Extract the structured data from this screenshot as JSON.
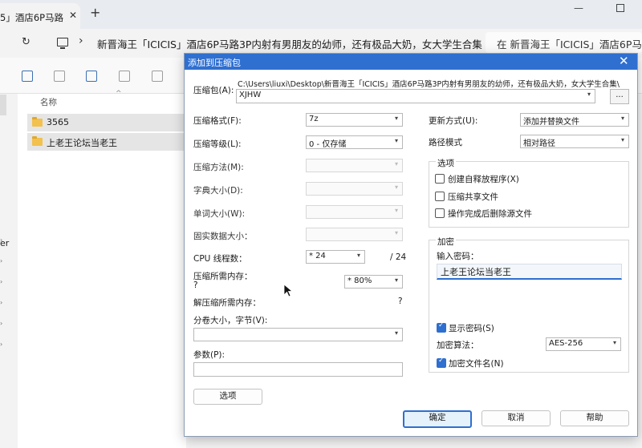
{
  "browser": {
    "tab_title": "5」酒店6P马路",
    "tab_close": "✕",
    "new_tab": "+",
    "refresh_icon": "↻",
    "breadcrumb_sep": "›",
    "path": "新晋海王「ICICIS」酒店6P马路3P内射有男朋友的幼师，还有极品大奶，女大学生合集",
    "search_placeholder": "在 新晋海王「ICICIS」酒店6P马"
  },
  "window": {
    "minimize": "—"
  },
  "sidebar": {
    "partial_label": "er"
  },
  "filelist": {
    "column_name": "名称",
    "sort_indicator": "^",
    "items": [
      {
        "name": "3565"
      },
      {
        "name": "上老王论坛当老王"
      }
    ]
  },
  "dialog": {
    "title": "添加到压缩包",
    "close": "✕",
    "archive_label": "压缩包(A):",
    "archive_path": "C:\\Users\\liuxi\\Desktop\\新晋海王「ICICIS」酒店6P马路3P内射有男朋友的幼师，还有极品大奶，女大学生合集\\",
    "archive_name": "XJHW",
    "browse": "...",
    "format_label": "压缩格式(F):",
    "format_value": "7z",
    "level_label": "压缩等级(L):",
    "level_value": "0 - 仅存储",
    "method_label": "压缩方法(M):",
    "dict_label": "字典大小(D):",
    "word_label": "单词大小(W):",
    "solid_label": "固实数据大小：",
    "cpu_label": "CPU 线程数：",
    "cpu_value": "* 24",
    "cpu_total": "/ 24",
    "mem_comp_label": "压缩所需内存：",
    "mem_comp_hint": "?",
    "mem_comp_value": "* 80%",
    "mem_decomp_label": "解压缩所需内存：",
    "mem_decomp_value": "?",
    "volume_label": "分卷大小，字节(V):",
    "params_label": "参数(P):",
    "options_button": "选项",
    "update_label": "更新方式(U):",
    "update_value": "添加并替换文件",
    "pathmode_label": "路径模式",
    "pathmode_value": "相对路径",
    "options_group": "选项",
    "opt_sfx": "创建自释放程序(X)",
    "opt_shared": "压缩共享文件",
    "opt_delete": "操作完成后删除源文件",
    "encrypt_group": "加密",
    "pwd_label": "输入密码：",
    "pwd_value": "上老王论坛当老王",
    "show_pwd": "显示密码(S)",
    "enc_method_label": "加密算法：",
    "enc_method_value": "AES-256",
    "enc_names": "加密文件名(N)",
    "ok": "确定",
    "cancel": "取消",
    "help": "帮助"
  },
  "colors": {
    "accent": "#2f6fd0",
    "folder": "#f2c14e"
  }
}
